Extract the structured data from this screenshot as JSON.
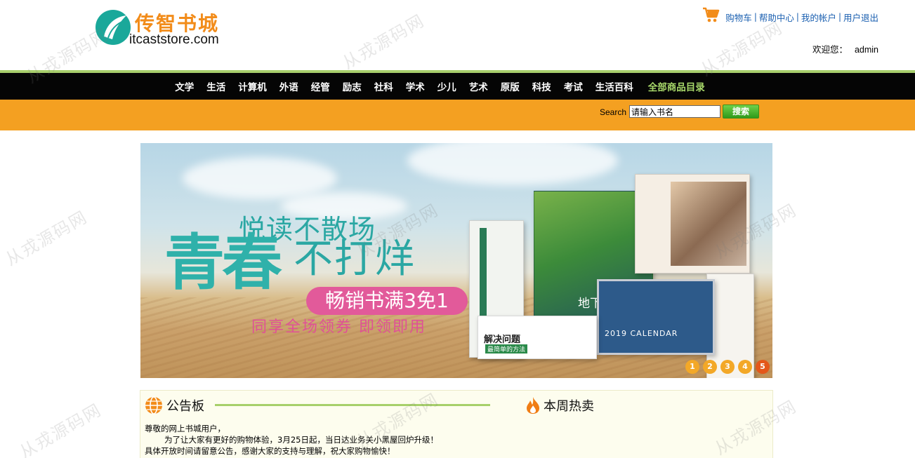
{
  "header": {
    "logo_cn": "传智书城",
    "logo_en": "itcaststore.com",
    "links": [
      "购物车",
      "帮助中心",
      "我的帐户",
      "用户退出"
    ],
    "welcome_label": "欢迎您：",
    "username": "admin"
  },
  "nav": {
    "items": [
      "文学",
      "生活",
      "计算机",
      "外语",
      "经管",
      "励志",
      "社科",
      "学术",
      "少儿",
      "艺术",
      "原版",
      "科技",
      "考试",
      "生活百科"
    ],
    "all_label": "全部商品目录"
  },
  "search": {
    "label": "Search",
    "value": "请输入书名",
    "button": "搜索"
  },
  "banner": {
    "line1": "悦读不散场",
    "line2a": "青春",
    "line2b": "不打烊",
    "pill": "畅销书满3免1",
    "line4": "同享全场领券  即领即用",
    "book_subway": "地下铁",
    "book_problem": "解决问题",
    "book_problem_sub": "最简单的方法",
    "book_calendar": "2019 CALENDAR",
    "dots": [
      "1",
      "2",
      "3",
      "4",
      "5"
    ],
    "active_dot": 5
  },
  "notice": {
    "title": "公告板",
    "hot_title": "本周热卖",
    "lines": [
      "尊敬的网上书城用户，",
      "为了让大家有更好的购物体验，3月25日起，当日达业务关小黑屋回炉升级！",
      "具体开放时间请留意公告，感谢大家的支持与理解，祝大家购物愉快！"
    ]
  },
  "watermark": "从戎源码网",
  "colors": {
    "nav_bg": "#050505",
    "nav_accent": "#a8cf6c",
    "search_bar": "#f4a021",
    "link_blue": "#1a5fb0",
    "logo_orange": "#f28c1a",
    "active_dot": "#e4571a"
  }
}
